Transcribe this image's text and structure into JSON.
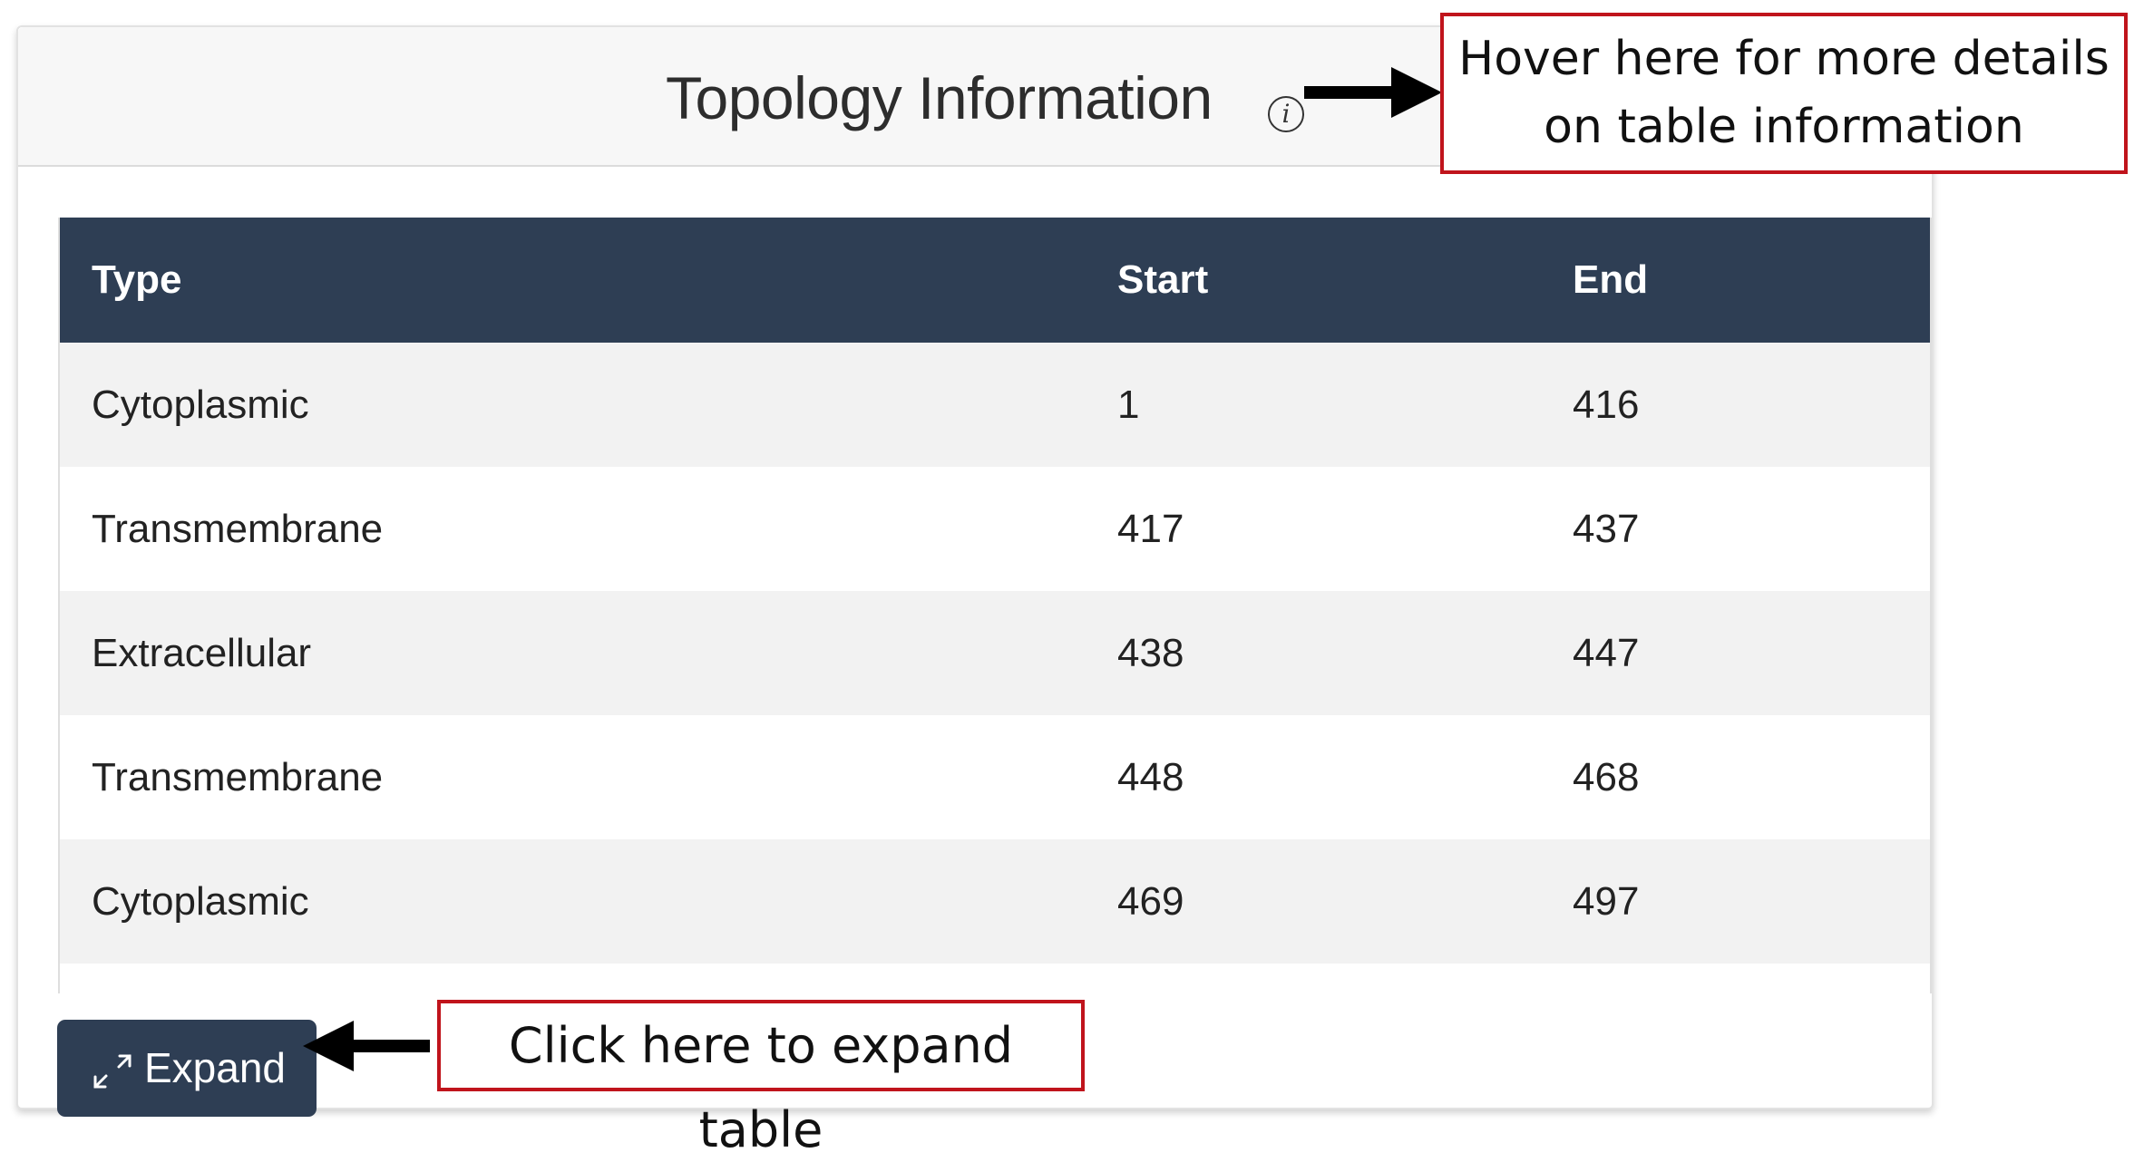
{
  "panel": {
    "title": "Topology Information",
    "info_icon": "info-icon"
  },
  "callouts": {
    "hover_text": "Hover here for more details on table information",
    "click_text": "Click here to expand table"
  },
  "table": {
    "headers": [
      "Type",
      "Start",
      "End"
    ],
    "rows": [
      [
        "Cytoplasmic",
        "1",
        "416"
      ],
      [
        "Transmembrane",
        "417",
        "437"
      ],
      [
        "Extracellular",
        "438",
        "447"
      ],
      [
        "Transmembrane",
        "448",
        "468"
      ],
      [
        "Cytoplasmic",
        "469",
        "497"
      ]
    ]
  },
  "expand_button": {
    "label": "Expand",
    "icon": "expand-arrows-icon"
  },
  "colors": {
    "header_bg": "#2e3e54",
    "button_bg": "#2e3e54",
    "callout_border": "#c0141c",
    "stripe": "#f2f2f2"
  }
}
